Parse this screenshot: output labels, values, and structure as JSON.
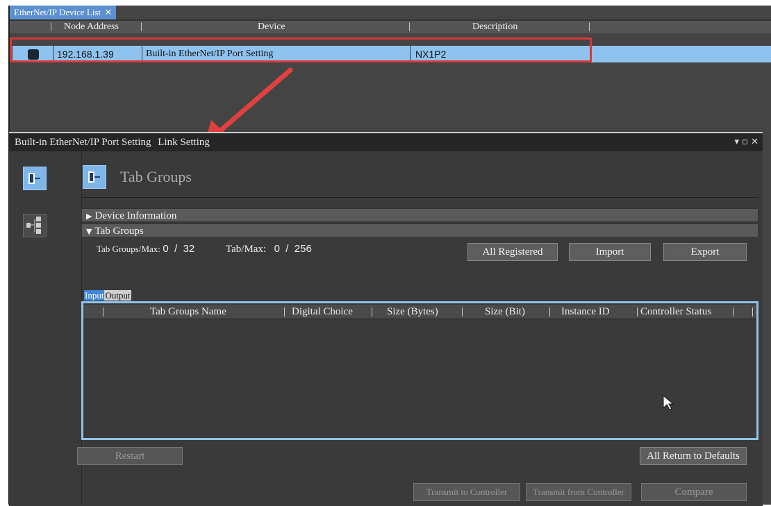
{
  "doc_tab": {
    "label": "EtherNet/IP Device List",
    "close": "✕"
  },
  "device_list": {
    "columns": [
      "Node Address",
      "Device",
      "Description"
    ],
    "rows": [
      {
        "node_address": "192.168.1.39",
        "device": "Built-in EtherNet/IP Port Setting",
        "description": "NX1P2"
      }
    ]
  },
  "sub_window": {
    "title": "Built-in EtherNet/IP Port Setting",
    "subtitle": "Link Setting",
    "controls": "▾ ▫ ✕"
  },
  "header": {
    "title": "Tab Groups"
  },
  "sections": {
    "device_information": "Device Information",
    "tab_groups": "Tab Groups"
  },
  "stats": {
    "tab_groups_label": "Tab Groups/Max:",
    "tab_groups_value": "0  /  32",
    "tab_label": "Tab/Max:",
    "tab_value": "0  /  256"
  },
  "buttons": {
    "all_registered": "All Registered",
    "import": "Import",
    "export": "Export",
    "restart": "Restart",
    "all_return_defaults": "All Return to Defaults",
    "transmit_to": "Transmit to Controller",
    "transmit_from": "Transmit from Controller",
    "compare": "Compare"
  },
  "io_tabs": {
    "input": "Input",
    "output": "Output"
  },
  "table": {
    "columns": [
      "Tab Groups Name",
      "Digital Choice",
      "Size (Bytes)",
      "Size (Bit)",
      "Instance ID",
      "Controller Status"
    ]
  },
  "colors": {
    "highlight": "#d83838",
    "selection": "#8ec3ef",
    "accent": "#7fb6e8"
  }
}
